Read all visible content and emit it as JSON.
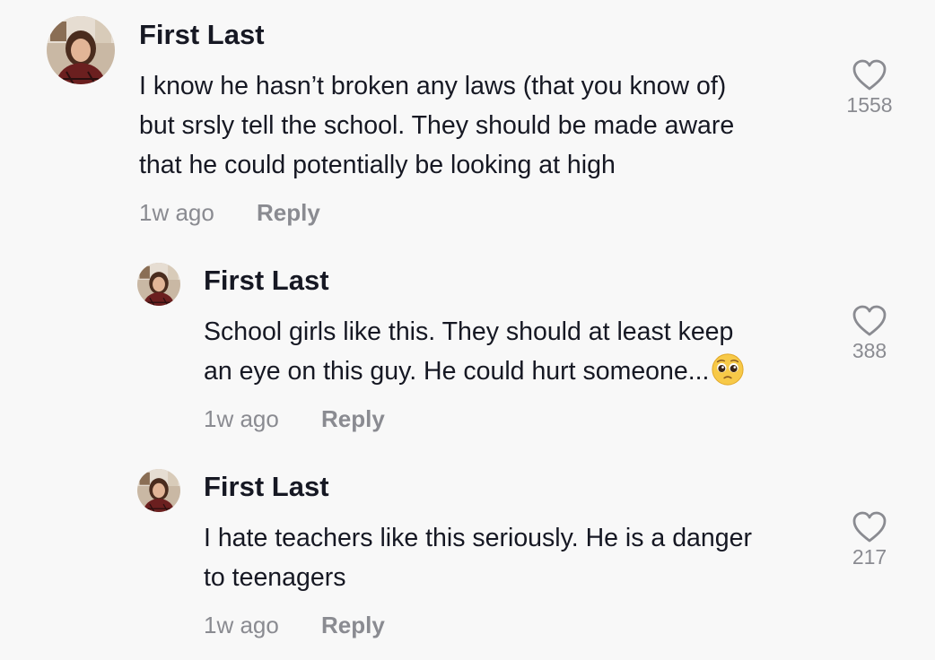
{
  "comments": [
    {
      "username": "First Last",
      "lines": [
        "I know he hasn’t broken any laws (that you know of)",
        "but srsly tell the school. They should be made aware",
        "that he could potentially be looking at high"
      ],
      "time": "1w ago",
      "reply_label": "Reply",
      "likes": "1558",
      "icon": "heart-outline-icon"
    },
    {
      "username": "First Last",
      "lines": [
        "School girls like this. They should at least keep",
        "an eye on this guy. He could hurt someone..."
      ],
      "emoji": "pleading-face-emoji",
      "time": "1w ago",
      "reply_label": "Reply",
      "likes": "388",
      "icon": "heart-outline-icon"
    },
    {
      "username": "First Last",
      "lines": [
        "I hate teachers like this seriously. He is a danger",
        "to teenagers"
      ],
      "time": "1w ago",
      "reply_label": "Reply",
      "likes": "217",
      "icon": "heart-outline-icon"
    }
  ],
  "colors": {
    "background": "#f8f8f8",
    "text": "#161823",
    "secondary": "#8a8b91"
  }
}
